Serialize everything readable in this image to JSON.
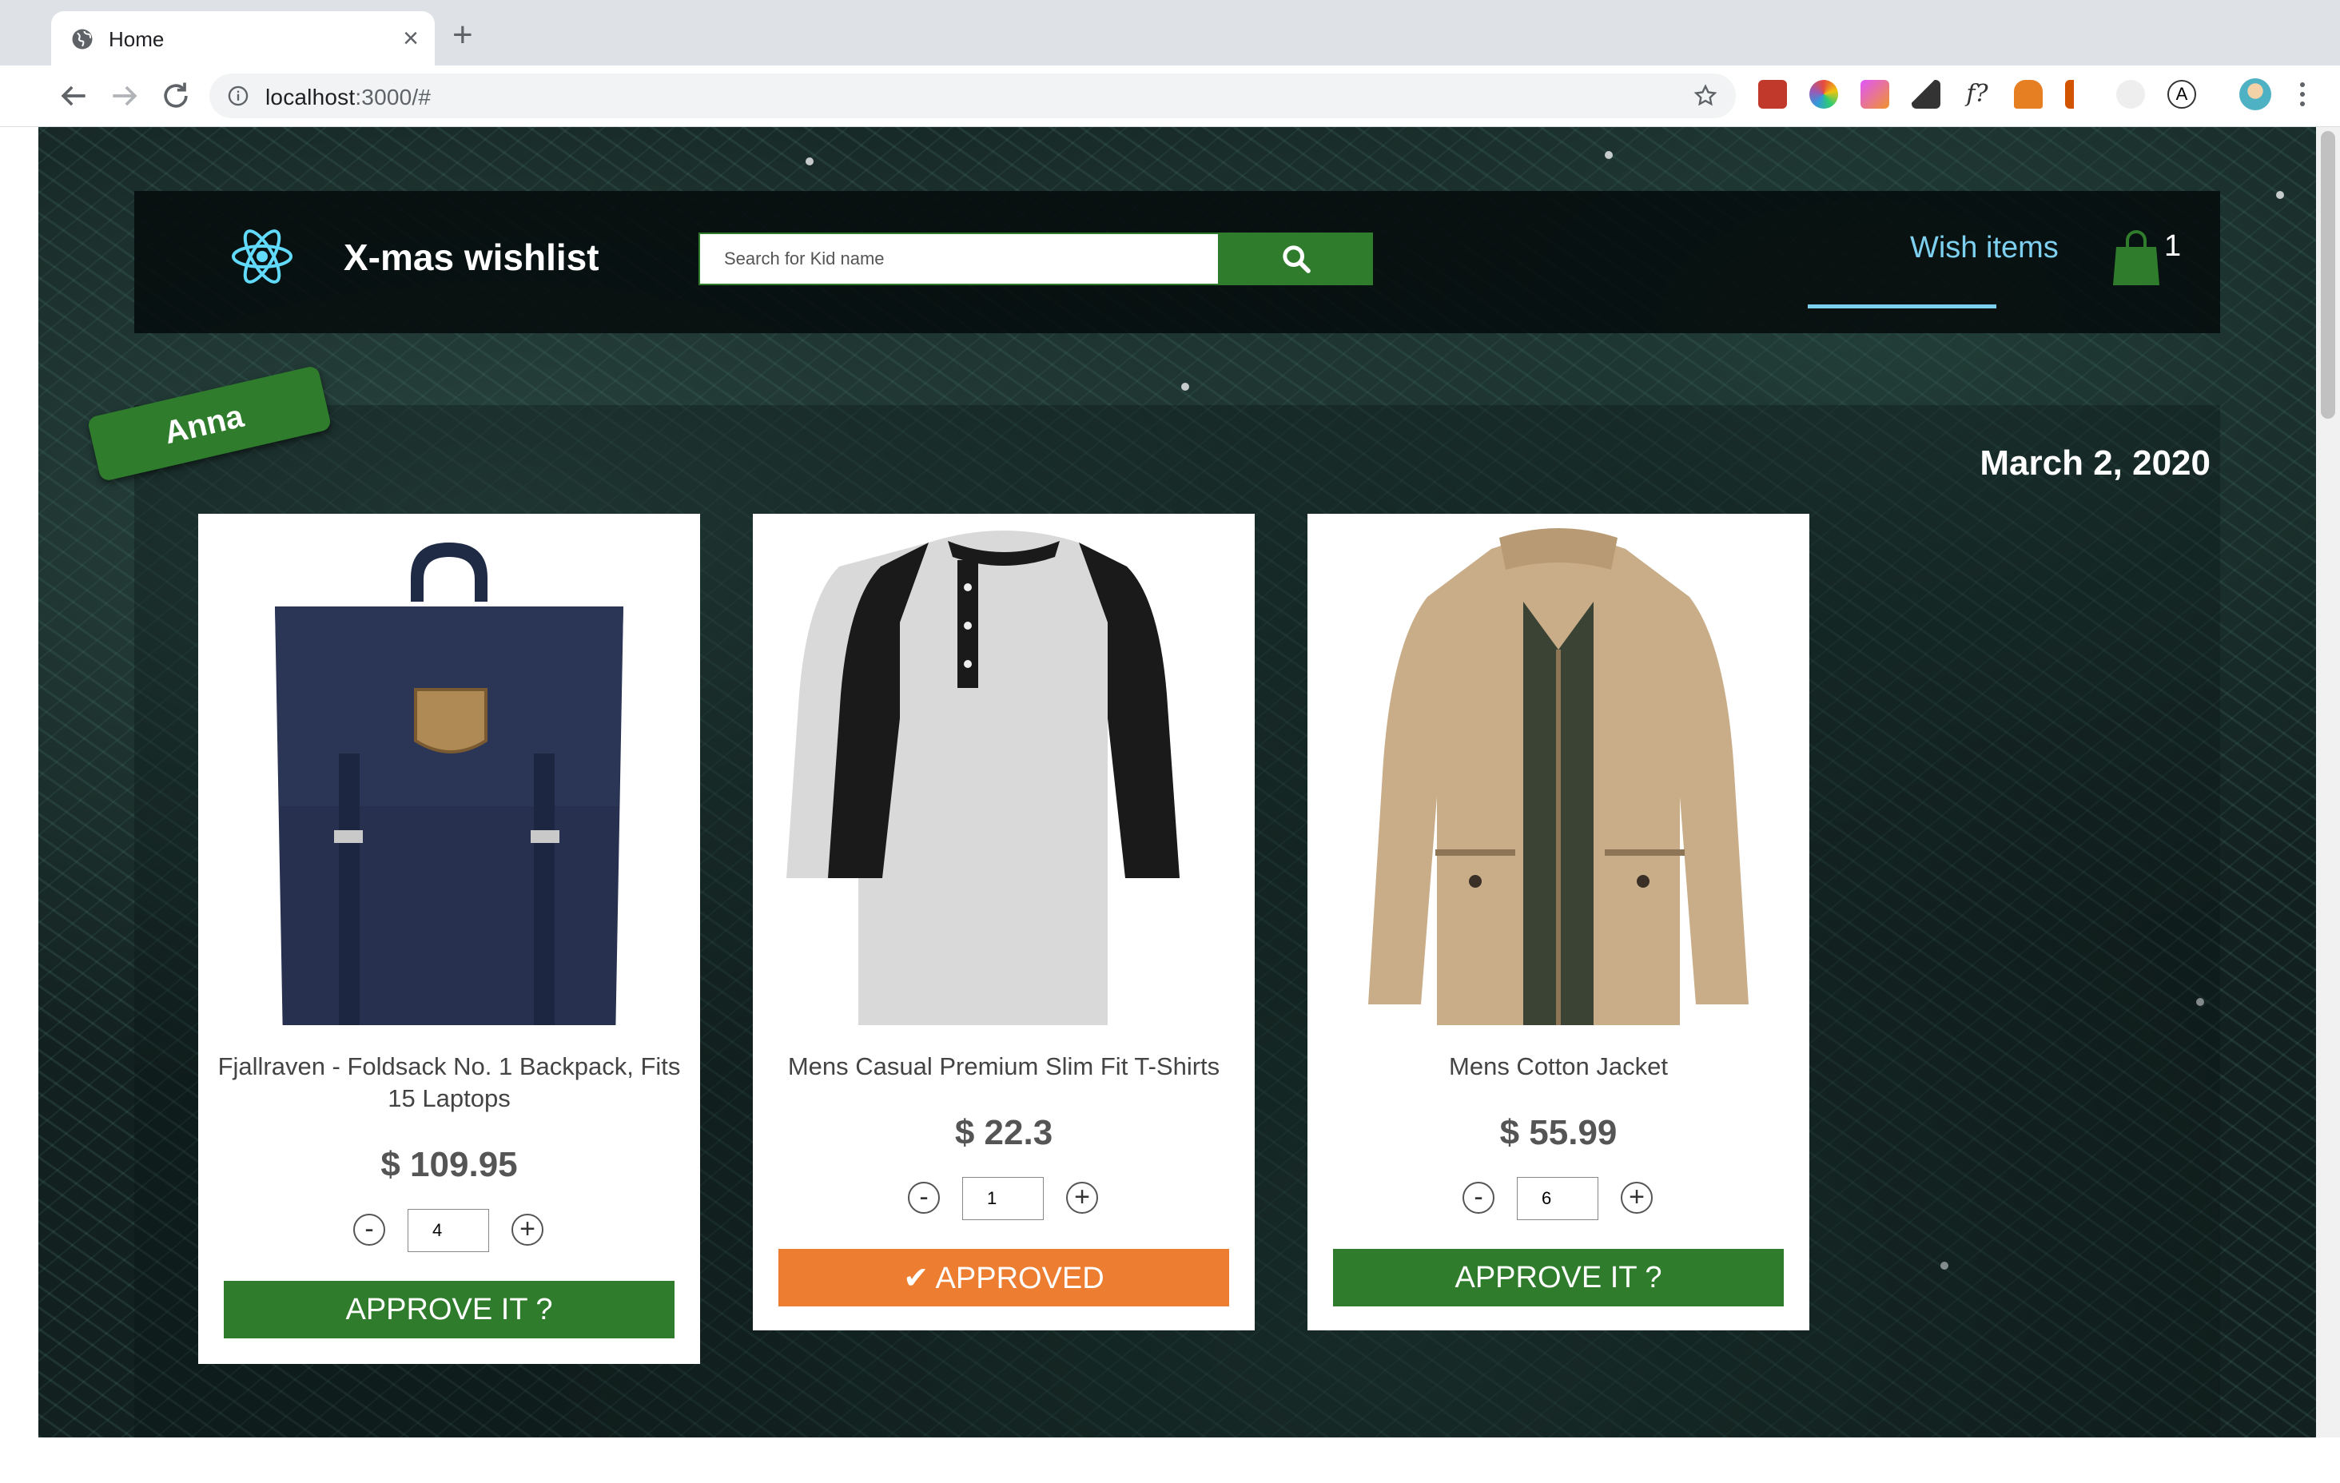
{
  "browser": {
    "tab_title": "Home",
    "url_host": "localhost",
    "url_path": ":3000/#"
  },
  "header": {
    "app_title": "X-mas wishlist",
    "search_placeholder": "Search for Kid name",
    "nav_wish_items": "Wish items",
    "cart_count": "1"
  },
  "wishlist": {
    "kid_name": "Anna",
    "date": "March 2, 2020",
    "items": [
      {
        "title": "Fjallraven - Foldsack No. 1 Backpack, Fits 15 Laptops",
        "price": "$ 109.95",
        "quantity": "4",
        "button_label": "APPROVE IT ?",
        "approved": false,
        "image": "navy-backpack"
      },
      {
        "title": "Mens Casual Premium Slim Fit T-Shirts",
        "price": "$ 22.3",
        "quantity": "1",
        "button_label": "✔ APPROVED",
        "approved": true,
        "image": "raglan-henley-shirt"
      },
      {
        "title": "Mens Cotton Jacket",
        "price": "$ 55.99",
        "quantity": "6",
        "button_label": "APPROVE IT ?",
        "approved": false,
        "image": "khaki-jacket"
      }
    ]
  },
  "colors": {
    "accent_green": "#2f7d2c",
    "approved_orange": "#ed7d31",
    "nav_blue": "#7ed0f0"
  }
}
